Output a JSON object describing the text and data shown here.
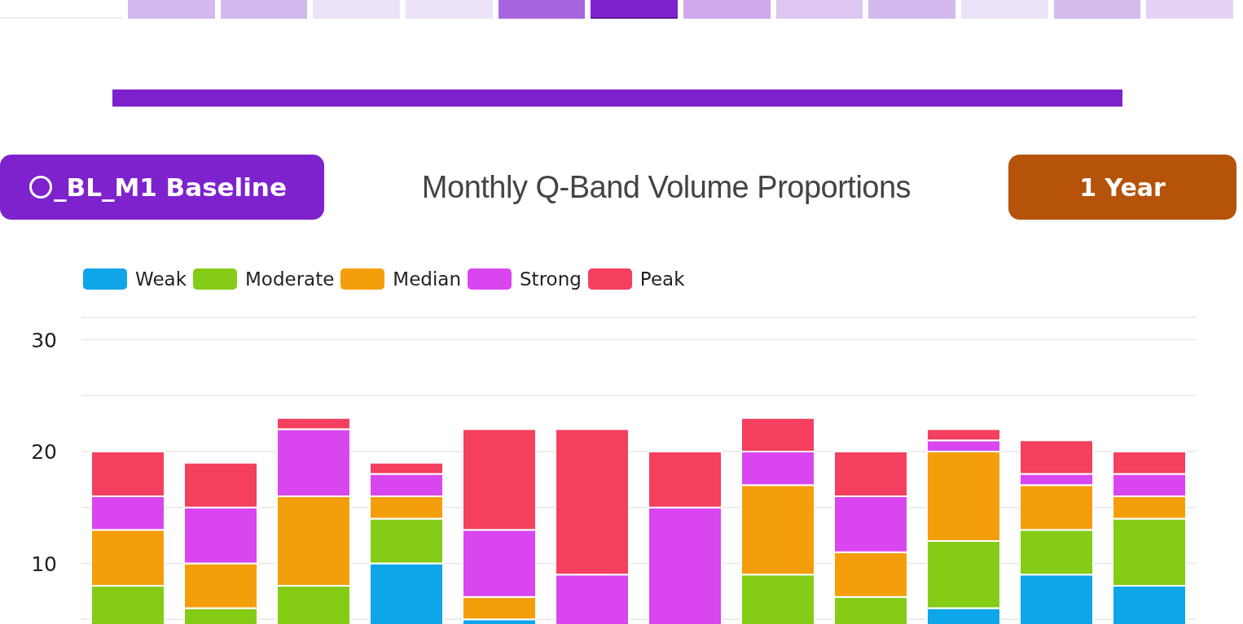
{
  "heatmap_strip": {
    "cells": [
      {
        "color": "#d4b8ee",
        "selected": false
      },
      {
        "color": "#d4b8ee",
        "selected": false
      },
      {
        "color": "#ede3f8",
        "selected": false
      },
      {
        "color": "#ede3f8",
        "selected": false
      },
      {
        "color": "#a766de",
        "selected": false
      },
      {
        "color": "#7e22ce",
        "selected": true
      },
      {
        "color": "#cfa9ec",
        "selected": false
      },
      {
        "color": "#ddc6f1",
        "selected": false
      },
      {
        "color": "#d4b8ee",
        "selected": false
      },
      {
        "color": "#ede3f8",
        "selected": false
      },
      {
        "color": "#d6bbef",
        "selected": false
      },
      {
        "color": "#e4d3f4",
        "selected": false
      }
    ]
  },
  "baseline_button": {
    "label": "_BL_M1 Baseline"
  },
  "chart_title": "Monthly Q-Band Volume Proportions",
  "range_button": {
    "label": "1 Year"
  },
  "chart_data": {
    "type": "bar",
    "stacked": true,
    "grid": true,
    "orientation": "vertical",
    "ylim": [
      0,
      32
    ],
    "yticks": [
      10,
      20,
      30
    ],
    "series": [
      {
        "name": "Weak",
        "color": "#0ea5e9",
        "values": [
          null,
          null,
          null,
          10,
          5,
          null,
          null,
          null,
          null,
          6,
          9,
          8
        ]
      },
      {
        "name": "Moderate",
        "color": "#84cc16",
        "values": [
          8,
          6,
          8,
          4,
          0,
          null,
          null,
          9,
          7,
          6,
          4,
          6
        ]
      },
      {
        "name": "Median",
        "color": "#f59e0b",
        "values": [
          5,
          4,
          8,
          2,
          2,
          null,
          null,
          8,
          4,
          8,
          4,
          2
        ]
      },
      {
        "name": "Strong",
        "color": "#d946ef",
        "values": [
          3,
          5,
          6,
          2,
          6,
          9,
          15,
          3,
          5,
          1,
          1,
          2
        ]
      },
      {
        "name": "Peak",
        "color": "#f43f5e",
        "values": [
          4,
          4,
          1,
          1,
          9,
          13,
          5,
          3,
          4,
          1,
          3,
          2
        ]
      }
    ]
  }
}
